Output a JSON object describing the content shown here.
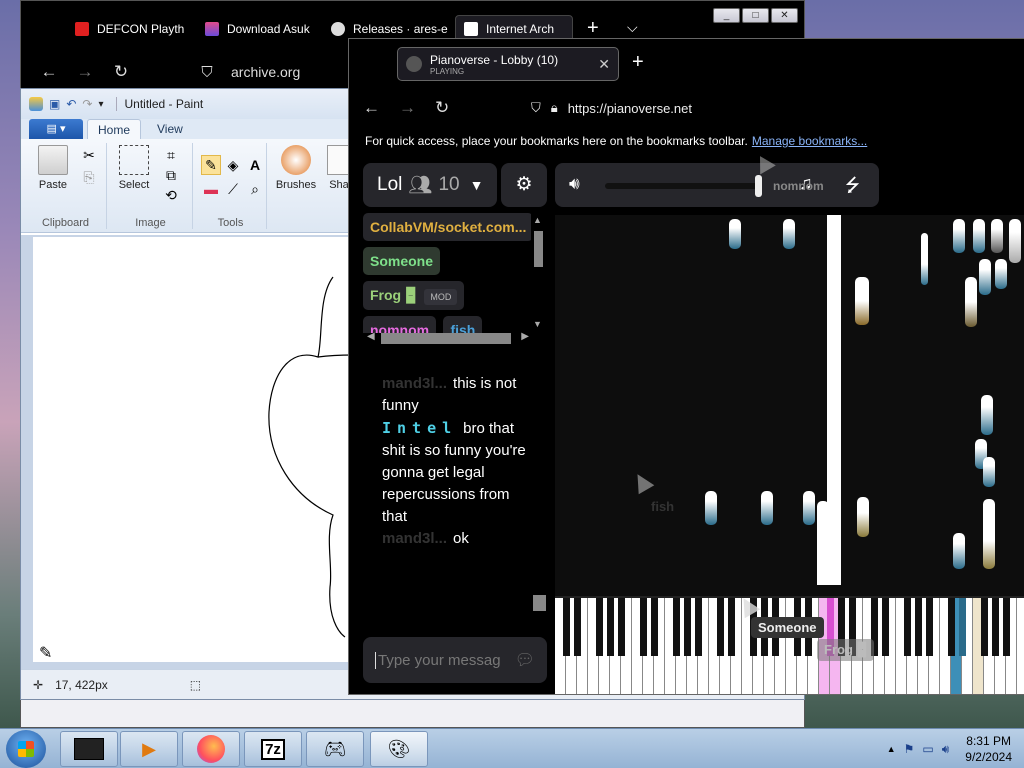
{
  "back_browser": {
    "tabs": [
      {
        "label": "DEFCON Playth"
      },
      {
        "label": "Download Asuk"
      },
      {
        "label": "Releases · ares-e"
      },
      {
        "label": "Internet Arch"
      }
    ],
    "url": "archive.org",
    "win_controls": [
      "_",
      "□",
      "✕"
    ]
  },
  "paint": {
    "title": "Untitled - Paint",
    "tabs": [
      "Home",
      "View"
    ],
    "groups": {
      "clipboard": {
        "label": "Clipboard",
        "paste": "Paste"
      },
      "image": {
        "label": "Image",
        "select": "Select"
      },
      "tools": {
        "label": "Tools"
      },
      "brushes": "Brushes",
      "shapes": "Sha"
    },
    "status": {
      "position": "17, 422px"
    }
  },
  "front_browser": {
    "tab": {
      "title": "Pianoverse - Lobby (10)",
      "subtitle": "PLAYING"
    },
    "url": "https://pianoverse.net",
    "bookmarks_text": "For quick access, place your bookmarks here on the bookmarks toolbar.",
    "bookmarks_link": "Manage bookmarks..."
  },
  "pianoverse": {
    "room_name": "Lol",
    "user_count": "10",
    "users": [
      {
        "name": "CollabVM/socket.com...",
        "color": "#e0b040"
      },
      {
        "name": "Someone",
        "color": "#7ee08a"
      },
      {
        "name": "Frog 🁢",
        "color": "#9bd07a",
        "badge": "MOD"
      },
      {
        "name": "nomnom",
        "color": "#e66be0"
      },
      {
        "name": "fish",
        "color": "#4aa0d8"
      }
    ],
    "chat": [
      {
        "name": "mand3l...",
        "text": "this is not funny"
      },
      {
        "name": "Intel",
        "text": "bro that shit is so funny you're gonna get legal repercussions from that"
      },
      {
        "name": "mand3l...",
        "text": "ok"
      }
    ],
    "chat_placeholder": "Type your messag",
    "cursors": {
      "nomnom": "nomnom",
      "fish": "fish",
      "someone": "Someone",
      "frog": "Frog 🁢"
    }
  },
  "taskbar": {
    "clock_time": "8:31 PM",
    "clock_date": "9/2/2024"
  }
}
